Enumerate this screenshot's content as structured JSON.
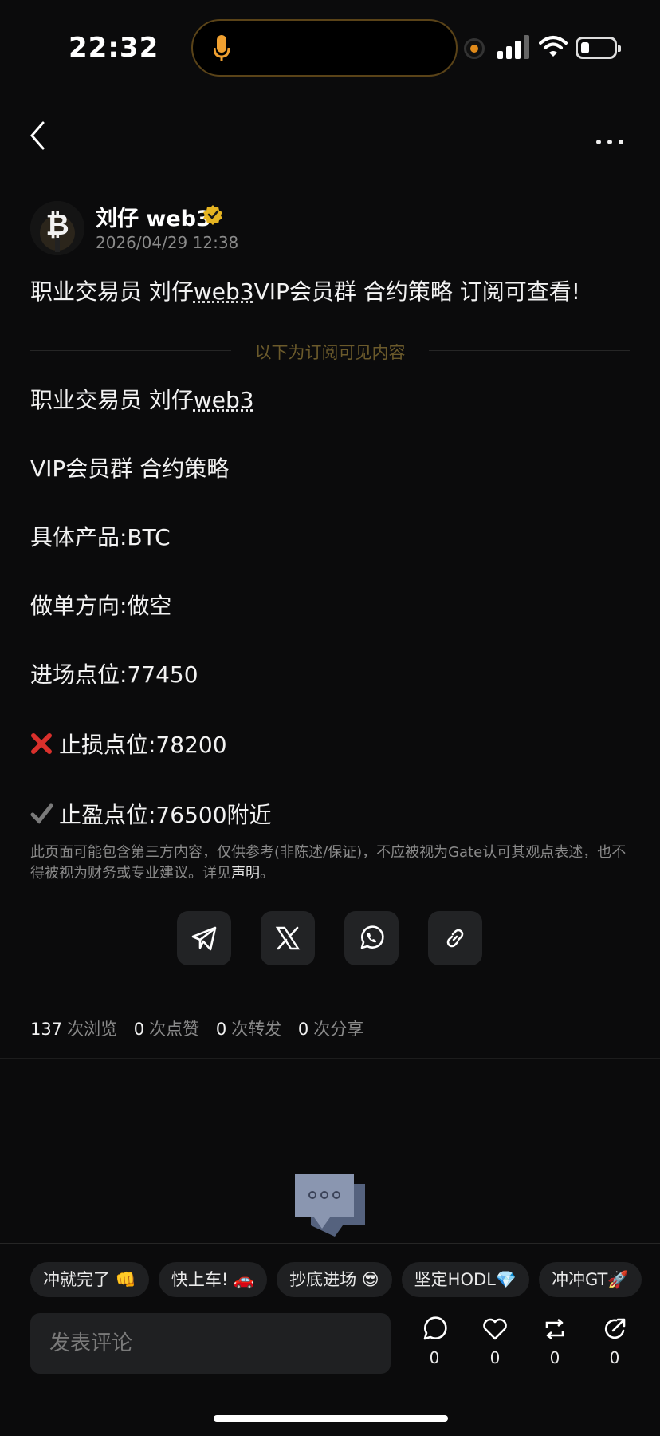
{
  "status_bar": {
    "time": "22:32"
  },
  "post": {
    "author": "刘仔 web3",
    "date": "2026/04/29 12:38",
    "title_pre": "职业交易员 刘仔",
    "title_link": "web3",
    "title_post": "VIP会员群 合约策略 订阅可查看!",
    "divider_label": "以下为订阅可见内容",
    "line1_pre": "职业交易员 刘仔",
    "line1_link": "web3",
    "line2": "VIP会员群 合约策略",
    "line3": "具体产品:BTC",
    "line4": "做单方向:做空",
    "line5": "进场点位:77450",
    "line6": "止损点位:78200",
    "line7": "止盈点位:76500附近",
    "disclaimer_text": "此页面可能包含第三方内容，仅供参考(非陈述/保证)，不应被视为Gate认可其观点表述，也不得被视为财务或专业建议。详见",
    "disclaimer_link": "声明",
    "disclaimer_end": "。"
  },
  "share_icons": [
    "telegram-icon",
    "x-icon",
    "whatsapp-icon",
    "link-icon"
  ],
  "stats": {
    "views": "137",
    "views_label": "次浏览",
    "likes": "0",
    "likes_label": "次点赞",
    "reposts": "0",
    "reposts_label": "次转发",
    "shares": "0",
    "shares_label": "次分享"
  },
  "quick_replies": [
    "冲就完了 👊",
    "快上车! 🚗",
    "抄底进场 😎",
    "坚定HODL💎",
    "冲冲GT🚀"
  ],
  "comment_placeholder": "发表评论",
  "actions": {
    "comment": "0",
    "like": "0",
    "repost": "0",
    "share": "0"
  },
  "colors": {
    "background": "#0b0b0c",
    "verified": "#e6b422",
    "cross": "#d9302c",
    "accent": "#e08a1a"
  }
}
